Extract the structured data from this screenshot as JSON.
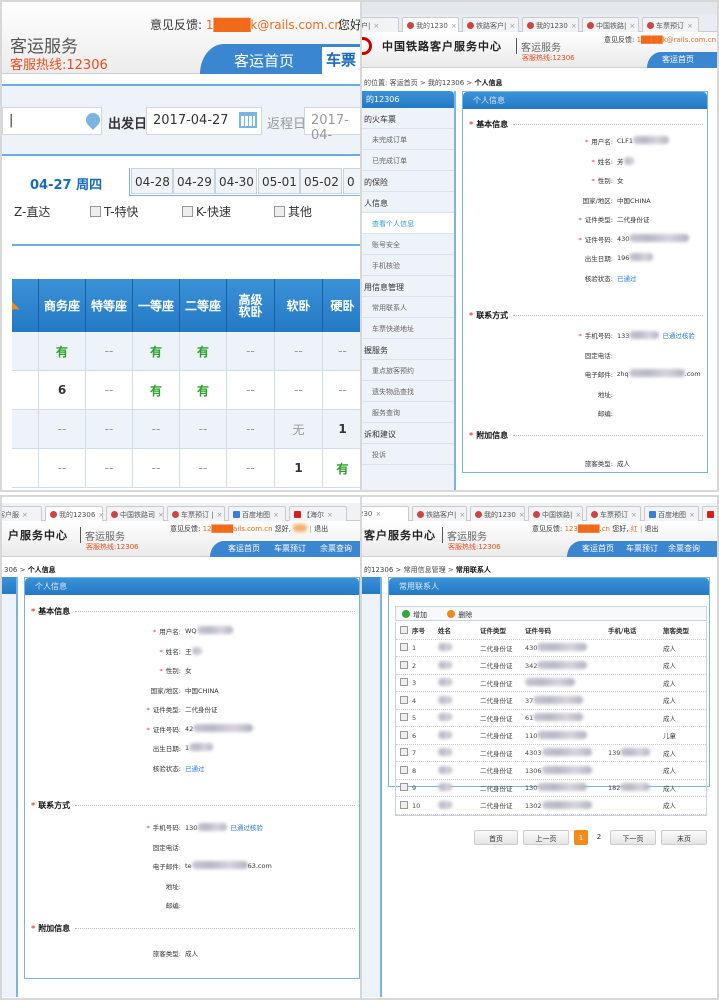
{
  "panel1": {
    "feedback_label": "意见反馈:",
    "feedback_email": "1████k@rails.com.cn",
    "greeting": "您好",
    "brand": "客运服务",
    "hotline": "客服热线:12306",
    "nav": {
      "home": "客运首页",
      "tickets": "车票"
    },
    "search": {
      "from_value": "",
      "depart_label": "出发日",
      "depart_date": "2017-04-27",
      "return_label": "返程日",
      "return_date": "2017-04-"
    },
    "date_tabs": {
      "active": "04-27 周四",
      "others": [
        "04-28",
        "04-29",
        "04-30",
        "05-01",
        "05-02",
        "0"
      ]
    },
    "filters": [
      "Z-直达",
      "T-特快",
      "K-快速",
      "其他"
    ],
    "table": {
      "headers": [
        "",
        "商务座",
        "特等座",
        "一等座",
        "二等座",
        "高级软卧",
        "软卧",
        "硬卧"
      ],
      "rows": [
        [
          "",
          "有",
          "--",
          "有",
          "有",
          "--",
          "--",
          "--"
        ],
        [
          "",
          "6",
          "--",
          "有",
          "有",
          "--",
          "--",
          "--"
        ],
        [
          "",
          "--",
          "--",
          "--",
          "--",
          "--",
          "无",
          "1"
        ],
        [
          "",
          "--",
          "--",
          "--",
          "--",
          "--",
          "1",
          "有"
        ]
      ]
    }
  },
  "panel2": {
    "browser_tabs": [
      {
        "label": "路客户|",
        "active": false
      },
      {
        "label": "我的1230",
        "active": true
      },
      {
        "label": "铁路客户|",
        "active": false
      },
      {
        "label": "我的1230",
        "active": false
      },
      {
        "label": "中国铁路|",
        "active": false
      },
      {
        "label": "车票预订",
        "active": false
      }
    ],
    "logo_text": "中国铁路客户服务中心",
    "logo_sub": "客运服务",
    "hotline": "客服热线:12306",
    "feedback_label": "意见反馈:",
    "feedback_email": "1████k@rails.com.cn",
    "nav": {
      "home": "客运首页"
    },
    "breadcrumb": {
      "prefix": "的位置:",
      "items": [
        "客运首页",
        "我的12306"
      ],
      "current": "个人信息"
    },
    "sidebar": {
      "title": "的12306",
      "items": [
        {
          "label": "的火车票",
          "type": "group"
        },
        {
          "label": "未完成订单",
          "type": "sub"
        },
        {
          "label": "已完成订单",
          "type": "sub"
        },
        {
          "label": "的保险",
          "type": "group"
        },
        {
          "label": "人信息",
          "type": "group"
        },
        {
          "label": "查看个人信息",
          "type": "sub",
          "active": true
        },
        {
          "label": "账号安全",
          "type": "sub"
        },
        {
          "label": "手机核验",
          "type": "sub"
        },
        {
          "label": "用信息管理",
          "type": "group"
        },
        {
          "label": "常用联系人",
          "type": "sub"
        },
        {
          "label": "车票快递地址",
          "type": "sub"
        },
        {
          "label": "握服务",
          "type": "group"
        },
        {
          "label": "重点旅客预约",
          "type": "sub"
        },
        {
          "label": "遗失物品查找",
          "type": "sub"
        },
        {
          "label": "服务查询",
          "type": "sub"
        },
        {
          "label": "诉和建议",
          "type": "group"
        },
        {
          "label": "投诉",
          "type": "sub"
        }
      ]
    },
    "content_title": "个人信息",
    "sections": {
      "basic": "基本信息",
      "contact": "联系方式",
      "extra": "附加信息"
    },
    "basic": {
      "username_label": "用户名:",
      "username": "CLF1",
      "name_label": "姓名:",
      "name": "芳",
      "gender_label": "性别:",
      "gender": "女",
      "country_label": "国家/地区:",
      "country": "中国CHINA",
      "idtype_label": "证件类型:",
      "idtype": "二代身份证",
      "idno_label": "证件号码:",
      "idno": "430",
      "birth_label": "出生日期:",
      "birth": "196",
      "verify_label": "核验状态:",
      "verify": "已通过"
    },
    "contact": {
      "mobile_label": "手机号码:",
      "mobile": "133",
      "mobile_status": "已通过核验",
      "phone_label": "固定电话:",
      "email_label": "电子邮件:",
      "email_prefix": "zhq",
      "email_suffix": ".com",
      "address_label": "地址:",
      "zip_label": "邮编:"
    },
    "extra": {
      "passenger_type_label": "旅客类型:",
      "passenger_type": "成人"
    }
  },
  "panel3": {
    "browser_tabs": [
      {
        "label": "客户服",
        "active": false,
        "icon": "rail"
      },
      {
        "label": "我的12306",
        "active": true,
        "icon": "rail"
      },
      {
        "label": "中国铁路司",
        "active": false,
        "icon": "rail"
      },
      {
        "label": "车票预订 |",
        "active": false,
        "icon": "rail"
      },
      {
        "label": "百度地图",
        "active": false,
        "icon": "map"
      },
      {
        "label": "【海尔",
        "active": false,
        "icon": "jd"
      }
    ],
    "logo_text": "户服务中心",
    "logo_sub": "客运服务",
    "hotline": "客服热线:12306",
    "feedback_label": "意见反馈:",
    "feedback_email": "12████ails.com.cn",
    "greeting": "您好,",
    "logout": "退出",
    "nav": [
      "客运首页",
      "车票预订",
      "余票查询"
    ],
    "breadcrumb": {
      "prefix": "306 >",
      "current": "个人信息"
    },
    "content_title": "个人信息",
    "sections": {
      "basic": "基本信息",
      "contact": "联系方式",
      "extra": "附加信息"
    },
    "basic": {
      "username_label": "用户名:",
      "username": "WQ",
      "name_label": "姓名:",
      "name": "王",
      "gender_label": "性别:",
      "gender": "女",
      "country_label": "国家/地区:",
      "country": "中国CHINA",
      "idtype_label": "证件类型:",
      "idtype": "二代身份证",
      "idno_label": "证件号码:",
      "idno": "42",
      "birth_label": "出生日期:",
      "birth": "1",
      "verify_label": "核验状态:",
      "verify": "已通过"
    },
    "contact": {
      "mobile_label": "手机号码:",
      "mobile": "130",
      "mobile_status": "已通过核验",
      "phone_label": "固定电话:",
      "email_label": "电子邮件:",
      "email_prefix": "te",
      "email_suffix": "63.com",
      "address_label": "地址:",
      "zip_label": "邮编:"
    },
    "extra": {
      "passenger_type_label": "旅客类型:",
      "passenger_type": "成人"
    }
  },
  "panel4": {
    "browser_tabs": [
      {
        "label": "230",
        "active": true,
        "icon": "none"
      },
      {
        "label": "铁路客户|",
        "active": false,
        "icon": "rail"
      },
      {
        "label": "我的1230",
        "active": false,
        "icon": "rail"
      },
      {
        "label": "中国铁路|",
        "active": false,
        "icon": "rail"
      },
      {
        "label": "车票预订",
        "active": false,
        "icon": "rail"
      },
      {
        "label": "百度地图",
        "active": false,
        "icon": "map"
      },
      {
        "label": "【",
        "active": false,
        "icon": "jd"
      }
    ],
    "logo_text": "客户服务中心",
    "logo_sub": "客运服务",
    "hotline": "客服热线:12306",
    "feedback_label": "意见反馈:",
    "feedback_email": "123████.cn",
    "greeting": "您好,",
    "user": "红",
    "logout": "退出",
    "nav": [
      "客运首页",
      "车票预订",
      "余票查询"
    ],
    "breadcrumb": {
      "prefix": "的12306 >",
      "middle": "常用信息管理 >",
      "current": "常用联系人"
    },
    "content_title": "常用联系人",
    "toolbar": {
      "add": "增加",
      "delete": "删除"
    },
    "table": {
      "headers": [
        "序号",
        "姓名",
        "证件类型",
        "证件号码",
        "手机/电话",
        "旅客类型"
      ],
      "rows": [
        {
          "no": "1",
          "name": "",
          "idtype": "二代身份证",
          "idno": "430",
          "phone": "",
          "type": "成人"
        },
        {
          "no": "2",
          "name": "",
          "idtype": "二代身份证",
          "idno": "342",
          "phone": "",
          "type": "成人"
        },
        {
          "no": "3",
          "name": "",
          "idtype": "二代身份证",
          "idno": "",
          "phone": "",
          "type": "成人"
        },
        {
          "no": "4",
          "name": "",
          "idtype": "二代身份证",
          "idno": "37",
          "phone": "",
          "type": "成人"
        },
        {
          "no": "5",
          "name": "",
          "idtype": "二代身份证",
          "idno": "61",
          "phone": "",
          "type": "成人"
        },
        {
          "no": "6",
          "name": "",
          "idtype": "二代身份证",
          "idno": "110",
          "phone": "",
          "type": "儿童"
        },
        {
          "no": "7",
          "name": "",
          "idtype": "二代身份证",
          "idno": "4303",
          "phone": "139",
          "type": "成人"
        },
        {
          "no": "8",
          "name": "",
          "idtype": "二代身份证",
          "idno": "1306",
          "phone": "",
          "type": "成人"
        },
        {
          "no": "9",
          "name": "",
          "idtype": "二代身份证",
          "idno": "130",
          "phone": "182",
          "type": "成人"
        },
        {
          "no": "10",
          "name": "",
          "idtype": "二代身份证",
          "idno": "1302",
          "phone": "",
          "type": "成人"
        }
      ]
    },
    "pager": {
      "first": "首页",
      "prev": "上一页",
      "pages": [
        "1",
        "2"
      ],
      "current": "1",
      "next": "下一页",
      "last": "末页"
    }
  }
}
